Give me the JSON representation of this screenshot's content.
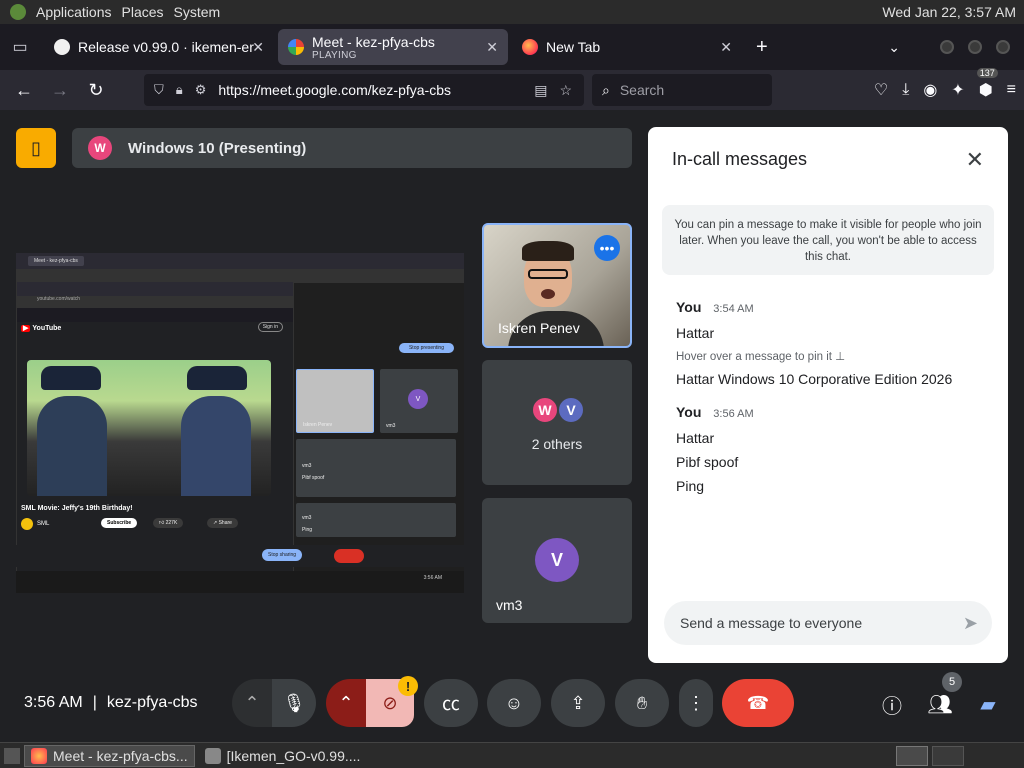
{
  "system_panel": {
    "menus": [
      "Applications",
      "Places",
      "System"
    ],
    "clock": "Wed Jan 22, 3:57 AM"
  },
  "browser": {
    "tabs": [
      {
        "title": "Release v0.99.0 · ikemen-er",
        "subtitle": "",
        "active": false
      },
      {
        "title": "Meet - kez-pfya-cbs",
        "subtitle": "PLAYING",
        "active": true
      },
      {
        "title": "New Tab",
        "subtitle": "",
        "active": false
      }
    ],
    "url": "https://meet.google.com/kez-pfya-cbs",
    "search_placeholder": "Search",
    "extension_badge": "137"
  },
  "meet": {
    "presenting_label": "Windows 10 (Presenting)",
    "presenter_initial": "W",
    "shared_screen": {
      "video_title": "SML Movie: Jeffy's 19th Birthday!",
      "channel": "SML",
      "subscribe_label": "Subscribe",
      "likes": "227K",
      "share_label": "Share",
      "stop_presenting_label": "Stop presenting",
      "stop_sharing_label": "Stop sharing",
      "tile_labels": [
        "Iskren Penev",
        "vm3",
        "vm3",
        "vm3"
      ],
      "tile_messages": [
        "Pibf spoof",
        "Ping"
      ],
      "youtube_label": "YouTube",
      "sign_in_label": "Sign in",
      "clock": "3:56 AM"
    },
    "participants": [
      {
        "name": "Iskren Penev"
      },
      {
        "name": "2 others",
        "initials": [
          "W",
          "V"
        ]
      },
      {
        "name": "vm3",
        "initial": "V"
      }
    ],
    "chat": {
      "title": "In-call messages",
      "info": "You can pin a message to make it visible for people who join later. When you leave the call, you won't be able to access this chat.",
      "groups": [
        {
          "sender": "You",
          "time": "3:54 AM",
          "messages": [
            "Hattar",
            "Hattar Windows 10 Corporative Edition 2026"
          ],
          "hint": "Hover over a message to pin it"
        },
        {
          "sender": "You",
          "time": "3:56 AM",
          "messages": [
            "Hattar",
            "Pibf spoof",
            "Ping"
          ]
        }
      ],
      "input_placeholder": "Send a message to everyone"
    },
    "controls": {
      "time": "3:56 AM",
      "meeting_code": "kez-pfya-cbs",
      "people_count": "5",
      "warning_badge": "!"
    }
  },
  "taskbar": {
    "items": [
      "Meet - kez-pfya-cbs...",
      "[Ikemen_GO-v0.99...."
    ]
  },
  "colors": {
    "accent_blue": "#8ab4f8",
    "hangup_red": "#ea4335",
    "layout_yellow": "#f9ab00"
  }
}
